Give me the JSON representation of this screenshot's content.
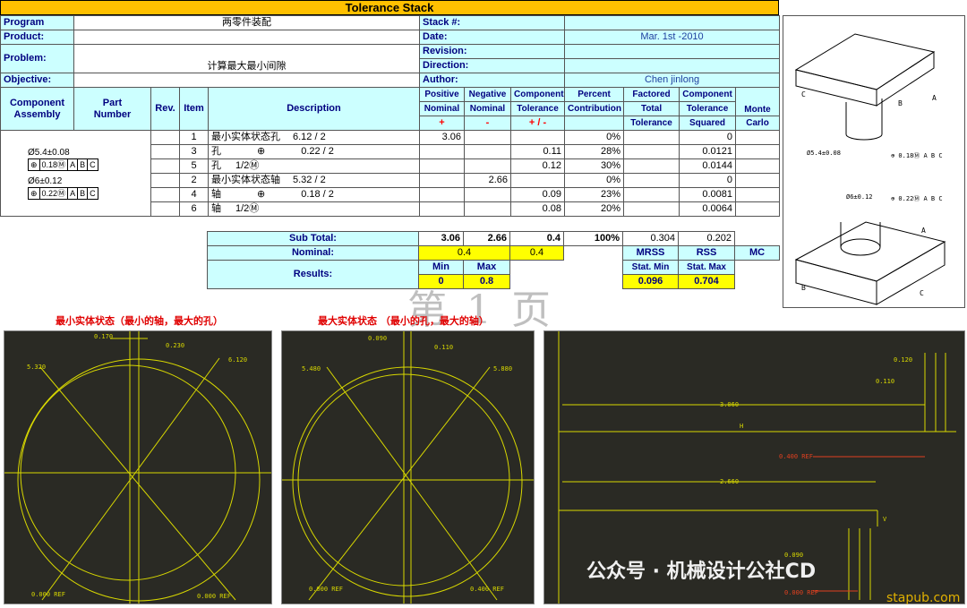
{
  "title": "Tolerance Stack",
  "header": {
    "program_label": "Program",
    "program_value": "两零件装配",
    "product_label": "Product:",
    "problem_label": "Problem:",
    "problem_value": "计算最大最小间隙",
    "objective_label": "Objective:",
    "stack_label": "Stack #:",
    "date_label": "Date:",
    "date_value": "Mar. 1st -2010",
    "revision_label": "Revision:",
    "direction_label": "Direction:",
    "author_label": "Author:",
    "author_value": "Chen jinlong"
  },
  "columns": {
    "component_assembly": "Component Assembly",
    "part_number": "Part Number",
    "rev": "Rev.",
    "item": "Item",
    "description": "Description",
    "positive_1": "Positive",
    "positive_2": "Nominal",
    "positive_sign": "+",
    "negative_1": "Negative",
    "negative_2": "Nominal",
    "negative_sign": "-",
    "component_1": "Component",
    "component_2": "Tolerance",
    "component_sign": "+ / -",
    "percent_1": "Percent",
    "percent_2": "Contribution",
    "factored_1": "Factored",
    "factored_2": "Total",
    "factored_3": "Tolerance",
    "comp_tol_1": "Component",
    "comp_tol_2": "Tolerance",
    "comp_tol_3": "Squared",
    "monte_1": "Monte",
    "monte_2": "Carlo"
  },
  "rows": [
    {
      "item": "1",
      "desc": "最小实体状态孔",
      "val": "6.12 / 2",
      "pos": "3.06",
      "neg": "",
      "tol": "",
      "pct": "0%",
      "sq": "0"
    },
    {
      "item": "3",
      "desc": "孔",
      "sym": "⊕",
      "val": "0.22 / 2",
      "pos": "",
      "neg": "",
      "tol": "0.11",
      "pct": "28%",
      "sq": "0.0121"
    },
    {
      "item": "5",
      "desc": "孔",
      "val": "1/2Ⓜ",
      "pos": "",
      "neg": "",
      "tol": "0.12",
      "pct": "30%",
      "sq": "0.0144"
    },
    {
      "item": "2",
      "desc": "最小实体状态轴",
      "val": "5.32 / 2",
      "pos": "",
      "neg": "2.66",
      "tol": "",
      "pct": "0%",
      "sq": "0"
    },
    {
      "item": "4",
      "desc": "轴",
      "sym": "⊕",
      "val": "0.18 / 2",
      "pos": "",
      "neg": "",
      "tol": "0.09",
      "pct": "23%",
      "sq": "0.0081"
    },
    {
      "item": "6",
      "desc": "轴",
      "val": "1/2Ⓜ",
      "pos": "",
      "neg": "",
      "tol": "0.08",
      "pct": "20%",
      "sq": "0.0064"
    }
  ],
  "gdt": {
    "dim1": "Ø5.4±0.08",
    "frame1": [
      "⊕",
      "0.18Ⓜ",
      "A",
      "B",
      "C"
    ],
    "dim2": "Ø6±0.12",
    "frame2": [
      "⊕",
      "0.22Ⓜ",
      "A",
      "B",
      "C"
    ]
  },
  "summary": {
    "subtotal_label": "Sub Total:",
    "subtotal_pos": "3.06",
    "subtotal_neg": "2.66",
    "subtotal_tol": "0.4",
    "subtotal_pct": "100%",
    "subtotal_factored": "0.304",
    "subtotal_sq": "0.202",
    "nominal_label": "Nominal:",
    "nominal_value": "0.4",
    "nominal_tol": "0.4",
    "results_label": "Results:",
    "min_label": "Min",
    "max_label": "Max",
    "min_value": "0",
    "max_value": "0.8",
    "mrss_label": "MRSS",
    "rss_label": "RSS",
    "mc_label": "MC",
    "stat_min_label": "Stat. Min",
    "stat_max_label": "Stat. Max",
    "stat_min_value": "0.096",
    "stat_max_value": "0.704"
  },
  "watermark_page": "第 1 页",
  "iso_top": {
    "a": "A",
    "b": "B",
    "c": "C",
    "dim": "Ø5.4±0.08",
    "frame": "⊕ 0.18Ⓜ A B C"
  },
  "iso_bottom": {
    "a": "A",
    "b": "B",
    "c": "C",
    "dim": "Ø6±0.12",
    "frame": "⊕ 0.22Ⓜ A B C"
  },
  "panel1": {
    "heading": "最小实体状态（最小的轴，最大的孔）",
    "d1": "0.170",
    "d2": "0.230",
    "l1": "5.320",
    "l2": "6.120",
    "ref1": "0.000 REF",
    "ref2": "0.000 REF"
  },
  "panel2": {
    "heading": "最大实体状态 （最小的孔，最大的轴）",
    "d1": "0.090",
    "d2": "0.110",
    "l1": "5.480",
    "l2": "5.880",
    "ref1": "0.000 REF",
    "ref2": "0.400 REF"
  },
  "panel3": {
    "d_top1": "0.120",
    "d_top2": "0.110",
    "len1": "3.060",
    "h": "H",
    "ref1": "0.400 REF",
    "len2": "2.660",
    "v": "V",
    "d_b1": "0.090",
    "ref2": "0.000 REF"
  },
  "footer_brand": "公众号 · 机械设计公社CD",
  "footer_site": "stapub.com"
}
